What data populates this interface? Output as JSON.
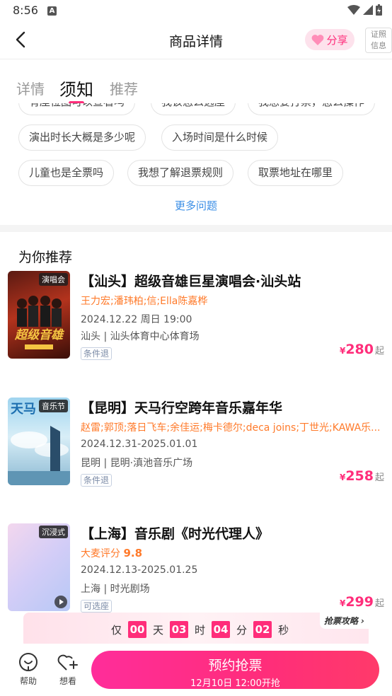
{
  "status_bar": {
    "time": "8:56"
  },
  "nav": {
    "title": "商品详情",
    "share_label": "分享",
    "cert_label_line1": "证照",
    "cert_label_line2": "信息"
  },
  "tabs": [
    {
      "label": "详情",
      "active": false
    },
    {
      "label": "须知",
      "active": true
    },
    {
      "label": "推荐",
      "active": false
    }
  ],
  "faq": {
    "partial_chips": [
      "有座位图可以查看吗",
      "我该怎么选座",
      "我想要打票，怎么操作"
    ],
    "chips": [
      "演出时长大概是多少呢",
      "入场时间是什么时候",
      "儿童也是全票吗",
      "我想了解退票规则",
      "取票地址在哪里"
    ],
    "more_label": "更多问题"
  },
  "recommend": {
    "section_title": "为你推荐",
    "items": [
      {
        "tag": "演唱会",
        "title": "【汕头】超级音雄巨星演唱会·汕头站",
        "artist": "王力宏;潘玮柏;信;Ella陈嘉桦",
        "date": "2024.12.22 周日 19:00",
        "venue": "汕头 | 汕头体育中心体育场",
        "badge": "条件退",
        "currency": "¥",
        "price": "280",
        "price_suffix": "起"
      },
      {
        "tag": "音乐节",
        "title": "【昆明】天马行空跨年音乐嘉年华",
        "artist": "赵雷;郭顶;落日飞车;余佳运;梅卡德尔;deca joins;丁世光;KAWA乐...",
        "date": "2024.12.31-2025.01.01",
        "venue": "昆明 | 昆明·滇池音乐广场",
        "badge": "条件退",
        "currency": "¥",
        "price": "258",
        "price_suffix": "起"
      },
      {
        "tag": "沉浸式",
        "title": "【上海】音乐剧《时光代理人》",
        "rating_label": "大麦评分",
        "rating": "9.8",
        "date": "2024.12.13-2025.01.25",
        "venue": "上海 | 时光剧场",
        "badge": "可选座",
        "currency": "¥",
        "price": "299",
        "price_suffix": "起"
      }
    ]
  },
  "countdown": {
    "prefix": "仅",
    "days": "00",
    "days_label": "天",
    "hours": "03",
    "hours_label": "时",
    "minutes": "04",
    "minutes_label": "分",
    "seconds": "02",
    "seconds_label": "秒",
    "strategy_label": "抢票攻略"
  },
  "bottom_bar": {
    "help_label": "帮助",
    "want_label": "想看",
    "cta_main": "预约抢票",
    "cta_sub": "12月10日 12:00开抢"
  },
  "colors": {
    "accent": "#ff2d7a",
    "artist": "#ff7a2a",
    "link": "#3a8ee6"
  }
}
